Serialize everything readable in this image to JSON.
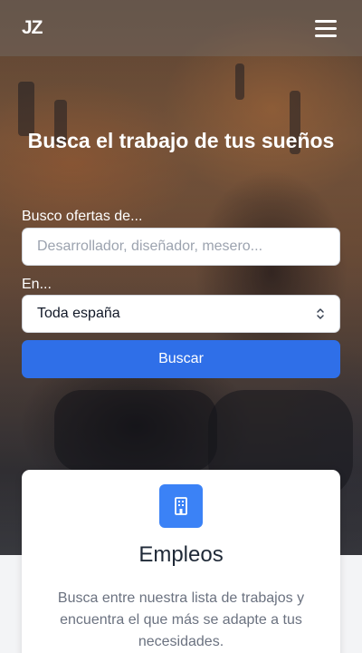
{
  "header": {
    "logo_text": "JZ",
    "menu_icon": "hamburger-menu-icon"
  },
  "hero": {
    "title": "Busca el trabajo de tus sueños"
  },
  "search": {
    "keyword_label": "Busco ofertas de...",
    "keyword_placeholder": "Desarrollador, diseñador, mesero...",
    "location_label": "En...",
    "location_value": "Toda españa",
    "button_label": "Buscar"
  },
  "card": {
    "icon": "building-icon",
    "title": "Empleos",
    "text": "Busca entre nuestra lista de trabajos y encuentra el que más se adapte a tus necesidades."
  },
  "colors": {
    "primary": "#2f6fe8",
    "icon_bg": "#3b82f6"
  }
}
